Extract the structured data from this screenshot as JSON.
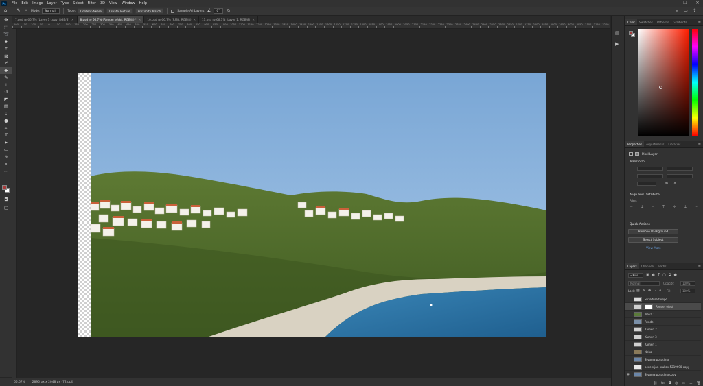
{
  "menubar": {
    "logo": "Ps",
    "items": [
      "File",
      "Edit",
      "Image",
      "Layer",
      "Type",
      "Select",
      "Filter",
      "3D",
      "View",
      "Window",
      "Help"
    ],
    "window_controls": [
      "—",
      "❐",
      "✕"
    ]
  },
  "options": {
    "mode_label": "Mode:",
    "mode_value": "Normal",
    "type_label": "Type:",
    "type_buttons": [
      "Content-Aware",
      "Create Texture",
      "Proximity Match"
    ],
    "sample_all_layers": "Sample All Layers",
    "angle_value": "0°"
  },
  "tabs": [
    {
      "label": "7.psd @ 66,7% (Layer 1 copy, RGB/8)",
      "active": false
    },
    {
      "label": "8.psd @ 66,7% (Render efekt, RGB/8) *",
      "active": true
    },
    {
      "label": "10.psd @ 66,7% (RMB, RGB/8)",
      "active": false
    },
    {
      "label": "11.psd @ 66,7% (Layer 1, RGB/8)",
      "active": false
    }
  ],
  "ruler_h_ticks": [
    "200",
    "150",
    "100",
    "50",
    "0",
    "50",
    "100",
    "150",
    "200",
    "250",
    "300",
    "350",
    "400",
    "450",
    "500",
    "550",
    "600",
    "650",
    "700",
    "750",
    "800",
    "850",
    "900",
    "950",
    "1000",
    "1050",
    "1100",
    "1150",
    "1200",
    "1250",
    "1300",
    "1350",
    "1400",
    "1450",
    "1500",
    "1550",
    "1600",
    "1650",
    "1700",
    "1750",
    "1800",
    "1850",
    "1900",
    "1950",
    "2000",
    "2050",
    "2100",
    "2150",
    "2200",
    "2250",
    "2300",
    "2350",
    "2400",
    "2450",
    "2500",
    "2550",
    "2600",
    "2650",
    "2700",
    "2750",
    "2800",
    "2850",
    "2900",
    "2950",
    "3000",
    "3050",
    "3100",
    "3150",
    "3200"
  ],
  "status": {
    "zoom": "66,67%",
    "doc_size": "2895 px x 2048 px (72 ppi)"
  },
  "color_panel": {
    "tabs": [
      "Color",
      "Swatches",
      "Patterns",
      "Gradients"
    ],
    "fg": "#a83b3b",
    "bg": "#ffffff",
    "hue_color": "#ff1e00"
  },
  "properties_panel": {
    "tabs": [
      "Properties",
      "Adjustments",
      "Libraries"
    ],
    "layer_type": "Pixel Layer",
    "transform_title": "Transform",
    "align_title": "Align and Distribute",
    "align_label": "Align:",
    "quick_actions_title": "Quick Actions",
    "remove_background": "Remove Background",
    "select_subject": "Select Subject",
    "view_more": "View More"
  },
  "layers_panel": {
    "tabs": [
      "Layers",
      "Channels",
      "Paths"
    ],
    "kind_label": "Kind",
    "blend_mode": "Normal",
    "opacity_label": "Opacity:",
    "opacity_value": "100%",
    "lock_label": "Lock:",
    "fill_label": "Fill:",
    "fill_value": "100%",
    "layers": [
      {
        "name": "Struktura tempo",
        "visible": false,
        "selected": false,
        "thumb": "#dcdcdc"
      },
      {
        "name": "Render efekt",
        "visible": false,
        "selected": true,
        "thumb": "#cfcfcf"
      },
      {
        "name": "Trava 1",
        "visible": false,
        "selected": false,
        "thumb": "#5a7a3a"
      },
      {
        "name": "Render",
        "visible": false,
        "selected": false,
        "thumb": "#7a8fa8"
      },
      {
        "name": "Kamen 2",
        "visible": false,
        "selected": false,
        "thumb": "#d0d0d0"
      },
      {
        "name": "Kamen 3",
        "visible": false,
        "selected": false,
        "thumb": "#d0d0d0"
      },
      {
        "name": "Kamen 1",
        "visible": false,
        "selected": false,
        "thumb": "#d0d0d0"
      },
      {
        "name": "Nebo",
        "visible": false,
        "selected": false,
        "thumb": "#8a7a5a"
      },
      {
        "name": "Stvarna pozadina",
        "visible": false,
        "selected": false,
        "thumb": "#6b86a8"
      },
      {
        "name": "pexels-jan-krukov-5219690 copy",
        "visible": false,
        "selected": false,
        "thumb": "#e8e8e8"
      },
      {
        "name": "Stvarna pozadina copy",
        "visible": true,
        "selected": false,
        "thumb": "#6b86a8"
      }
    ]
  },
  "colors": {
    "sky_top": "#7aa7d6",
    "sky_bottom": "#a9c9e9",
    "sea": "#2a6d9c",
    "hill": "#4f6b2a",
    "rock": "#d8d2c4"
  }
}
